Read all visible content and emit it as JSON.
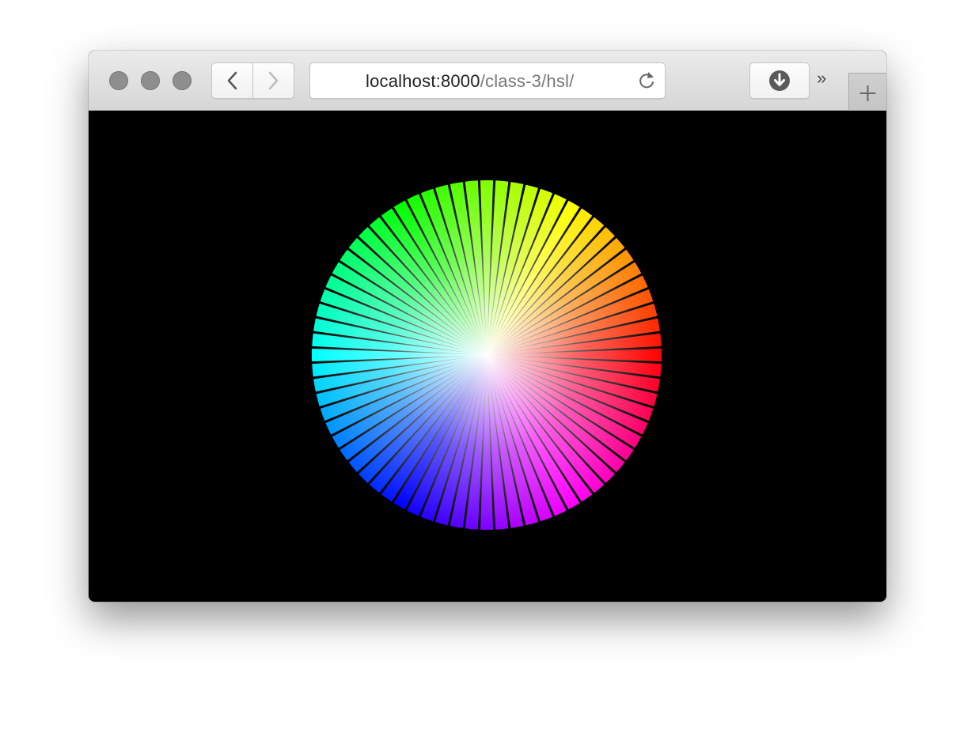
{
  "window": {
    "toolbar": {
      "traffic_lights": [
        "close",
        "minimize",
        "zoom"
      ],
      "traffic_light_color": "#8e8e8e",
      "back_icon": "chevron-left-icon",
      "forward_icon": "chevron-right-icon",
      "reload_icon": "reload-icon",
      "download_icon": "download-icon",
      "overflow_label": "»",
      "new_tab_icon": "plus-icon"
    },
    "url": {
      "host": "localhost:8000",
      "path": "/class-3/hsl/"
    }
  },
  "content": {
    "background_color": "#000000",
    "color_wheel": {
      "description_type": "hsl-hue-wheel",
      "hue_start_angle_deg": 0,
      "hue_direction": "counter-clockwise",
      "center_lightness": "white",
      "edge_lightness": 0.5,
      "segments": 72
    }
  }
}
